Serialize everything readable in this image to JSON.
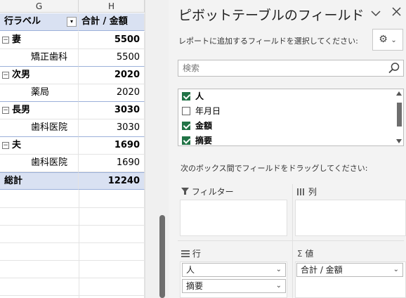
{
  "sheet": {
    "columns": [
      "G",
      "H"
    ],
    "header": {
      "row_label": "行ラベル",
      "value_label": "合計 / 金額"
    },
    "rows": [
      {
        "label": "妻",
        "value": "5500",
        "level": 0
      },
      {
        "label": "矯正歯科",
        "value": "5500",
        "level": 1
      },
      {
        "label": "次男",
        "value": "2020",
        "level": 0
      },
      {
        "label": "薬局",
        "value": "2020",
        "level": 1
      },
      {
        "label": "長男",
        "value": "3030",
        "level": 0
      },
      {
        "label": "歯科医院",
        "value": "3030",
        "level": 1
      },
      {
        "label": "夫",
        "value": "1690",
        "level": 0
      },
      {
        "label": "歯科医院",
        "value": "1690",
        "level": 1
      }
    ],
    "total": {
      "label": "総計",
      "value": "12240"
    },
    "collapse_symbol": "⊟"
  },
  "pane": {
    "title": "ピボットテーブルのフィールド",
    "choose_fields_text": "レポートに追加するフィールドを選択してください:",
    "search_placeholder": "検索",
    "fields": [
      {
        "label": "人",
        "checked": true
      },
      {
        "label": "年月日",
        "checked": false
      },
      {
        "label": "金額",
        "checked": true
      },
      {
        "label": "摘要",
        "checked": true
      }
    ],
    "drag_text": "次のボックス間でフィールドをドラッグしてください:",
    "areas": {
      "filters": {
        "label": "フィルター",
        "icon": "filter-icon"
      },
      "columns": {
        "label": "列",
        "icon": "columns-icon"
      },
      "rows": {
        "label": "行",
        "icon": "rows-icon",
        "items": [
          "人",
          "摘要"
        ]
      },
      "values": {
        "label": "値",
        "icon": "sigma-icon",
        "items": [
          "合計 / 金額"
        ]
      }
    }
  }
}
